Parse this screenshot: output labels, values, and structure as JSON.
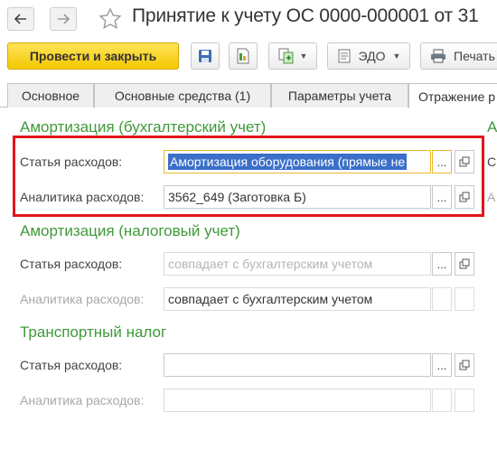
{
  "window": {
    "title": "Принятие к учету ОС 0000-000001 от 31"
  },
  "toolbar": {
    "post_close_label": "Провести и закрыть",
    "edo_label": "ЭДО",
    "print_label": "Печать"
  },
  "tabs": [
    {
      "label": "Основное"
    },
    {
      "label": "Основные средства (1)"
    },
    {
      "label": "Параметры учета"
    },
    {
      "label": "Отражение р"
    }
  ],
  "sections": {
    "accounting": {
      "heading": "Амортизация (бухгалтерский учет)",
      "right_heading_fragment": "Ам",
      "expense_item_label": "Статья расходов:",
      "expense_item_value": "Амортизация оборудования (прямые не",
      "analytics_label": "Аналитика расходов:",
      "analytics_value": "3562_649 (Заготовка Б)",
      "right_label_fragment_1": "С",
      "right_label_fragment_2": "А"
    },
    "tax": {
      "heading": "Амортизация (налоговый учет)",
      "expense_item_label": "Статья расходов:",
      "expense_item_placeholder": "совпадает с бухгалтерским учетом",
      "analytics_label": "Аналитика расходов:",
      "analytics_value": "совпадает с бухгалтерским учетом"
    },
    "transport": {
      "heading": "Транспортный налог",
      "expense_item_label": "Статья расходов:",
      "expense_item_value": "",
      "analytics_label": "Аналитика расходов:",
      "analytics_value": ""
    }
  },
  "buttons": {
    "select_label": "...",
    "open_icon": "open-icon"
  },
  "colors": {
    "accent_yellow": "#f4c800",
    "heading_green": "#3e9a3a",
    "highlight_red": "#e3141b",
    "selection_blue": "#3b6fc9",
    "focus_yellow": "#e8b82f"
  }
}
